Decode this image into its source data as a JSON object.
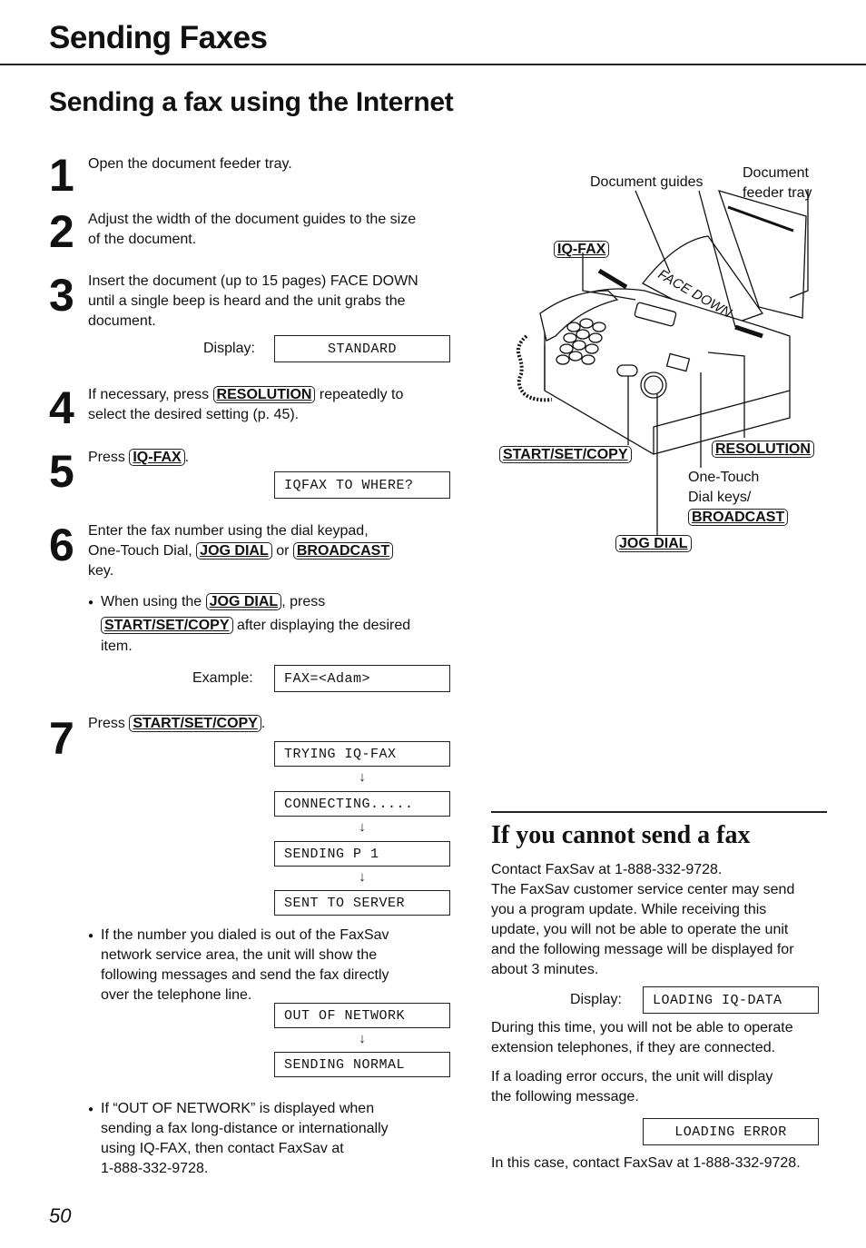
{
  "header": {
    "title": "Sending Faxes",
    "subtitle": "Sending a fax using the Internet"
  },
  "steps": [
    {
      "number": "1",
      "text": "Open the document feeder tray."
    },
    {
      "number": "2",
      "text_line1": "Adjust the width of the document guides to the size",
      "text_line2": "of the document."
    },
    {
      "number": "3",
      "text_line1": "Insert the document (up to 15 pages) FACE DOWN",
      "text_line2": "until a single beep is heard and the unit grabs the",
      "text_line3": "document.",
      "display_label": "Display:",
      "display": "STANDARD"
    },
    {
      "number": "4",
      "pre": "If necessary, press",
      "key": "RESOLUTION",
      "post": "repeatedly to",
      "text_line2": "select the desired setting (p. 45)."
    },
    {
      "number": "5",
      "pre": "Press",
      "key": "IQ-FAX",
      "post": ".",
      "display": "IQFAX TO WHERE?"
    },
    {
      "number": "6",
      "text_line1": "Enter the fax number using the dial keypad,",
      "line2_pre": "One-Touch Dial,",
      "key1": "JOG DIAL",
      "line2_mid": "or",
      "key2": "BROADCAST",
      "text_line3": "key.",
      "bullet": {
        "pre": "When using the",
        "key1": "JOG DIAL",
        "mid": ", press",
        "key2": "START/SET/COPY",
        "post": "after displaying the desired",
        "line3": "item."
      },
      "example_label": "Example:",
      "example_display": "FAX=<Adam>"
    },
    {
      "number": "7",
      "pre": "Press",
      "key": "START/SET/COPY",
      "post": ".",
      "displays": [
        "TRYING IQ-FAX",
        "CONNECTING.....",
        "SENDING P 1",
        "SENT TO SERVER"
      ],
      "bullet1": {
        "lines": [
          "If the number you dialed is out of the FaxSav",
          "network service area, the unit will show the",
          "following messages and send the fax directly",
          "over the telephone line."
        ]
      },
      "network_displays": [
        "OUT OF NETWORK",
        "SENDING NORMAL"
      ],
      "bullet2": {
        "lines": [
          "If “OUT OF NETWORK” is displayed when",
          "sending a fax long-distance or internationally",
          "using IQ-FAX, then contact FaxSav at",
          "1-888-332-9728."
        ]
      }
    }
  ],
  "figure": {
    "label_document_guides": "Document guides",
    "label_feeder_line1": "Document",
    "label_feeder_line2": "feeder tray",
    "face_down": "FACE DOWN",
    "key_iqfax": "IQ-FAX",
    "key_start": "START/SET/COPY",
    "key_resolution": "RESOLUTION",
    "one_touch_line1": "One-Touch",
    "one_touch_line2": "Dial keys/",
    "key_broadcast": "BROADCAST",
    "key_jog": "JOG DIAL"
  },
  "cannot_send": {
    "title": "If you cannot send a fax",
    "lines1": [
      "Contact FaxSav at 1-888-332-9728.",
      "The FaxSav customer service center may send",
      "you a program update. While receiving this",
      "update, you will not be able to operate the unit",
      "and the following message will be displayed for",
      "about 3 minutes."
    ],
    "display_label": "Display:",
    "display": "LOADING IQ-DATA",
    "lines2": [
      "During this time, you will not be able to operate",
      "extension telephones, if they are connected."
    ],
    "lines3": [
      "If a loading error occurs, the unit will display",
      "the following message."
    ],
    "error_display": "LOADING ERROR",
    "final": "In this case, contact FaxSav at 1-888-332-9728."
  },
  "footer": {
    "page_number": "50"
  },
  "arrow_glyph": "↓"
}
